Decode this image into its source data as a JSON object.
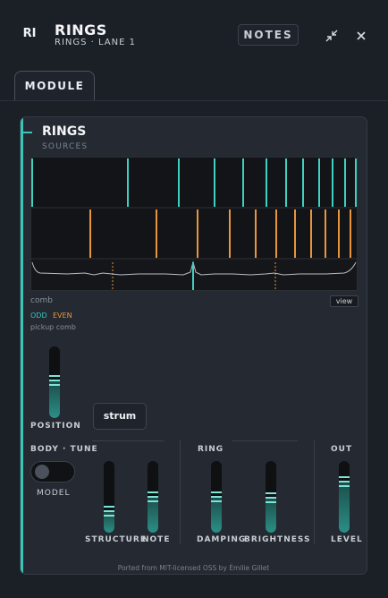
{
  "header": {
    "logo": "RI",
    "title": "RINGS",
    "subtitle": "RINGS · LANE 1",
    "notes_label": "NOTES",
    "collapse_icon": "collapse-icon",
    "close_icon": "close-icon"
  },
  "tabs": [
    {
      "label": "MODULE",
      "active": true
    }
  ],
  "module": {
    "title": "RINGS",
    "section_label": "SOURCES",
    "viz_label": "comb",
    "view_label": "view",
    "legend_odd": "ODD",
    "legend_even": "EVEN",
    "pickup_label": "pickup comb",
    "position": {
      "label": "POSITION",
      "value": 0.52
    },
    "strum_label": "strum",
    "sections": {
      "body_tune": {
        "title": "BODY · TUNE",
        "model_label": "MODEL",
        "model_on": false,
        "structure": {
          "label": "STRUCTURE",
          "value": 0.25
        },
        "note": {
          "label": "NOTE",
          "value": 0.5
        }
      },
      "ring": {
        "title": "RING",
        "damping": {
          "label": "DAMPING",
          "value": 0.5
        },
        "brightness": {
          "label": "BRIGHTNESS",
          "value": 0.48
        }
      },
      "out": {
        "title": "OUT",
        "level": {
          "label": "LEVEL",
          "value": 0.75
        }
      }
    },
    "footer": "Ported from MIT-licensed OSS by Émilie Gillet"
  },
  "colors": {
    "accent_teal": "#39c5b8",
    "accent_orange": "#e8953b",
    "background": "#1b1f26",
    "card": "#242932"
  }
}
